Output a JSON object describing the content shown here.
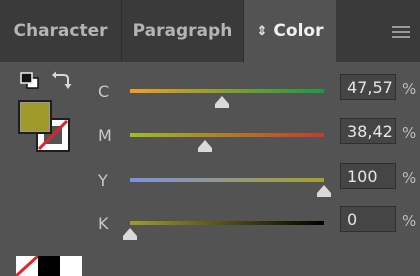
{
  "tabs": [
    {
      "label": "Character"
    },
    {
      "label": "Paragraph"
    },
    {
      "label": "Color"
    }
  ],
  "icons": {
    "tab_arrows": "⇕",
    "panel_menu": "menu-icon",
    "default_colors": "default-fill-stroke-icon",
    "swap": "swap-fill-stroke-icon"
  },
  "fill_color": "#9f9a2a",
  "sliders": [
    {
      "channel": "C",
      "value": "47,57",
      "unit": "%",
      "fraction": 0.4757,
      "gradient": [
        "#f0a020",
        "#1a9a45"
      ]
    },
    {
      "channel": "M",
      "value": "38,42",
      "unit": "%",
      "fraction": 0.3842,
      "gradient": [
        "#9abf22",
        "#c63a2b"
      ]
    },
    {
      "channel": "Y",
      "value": "100",
      "unit": "%",
      "fraction": 1.0,
      "gradient": [
        "#7f8fe0",
        "#a6a12a"
      ]
    },
    {
      "channel": "K",
      "value": "0",
      "unit": "%",
      "fraction": 0.0,
      "gradient": [
        "#a09c2a",
        "#000000"
      ]
    }
  ],
  "bottom_swatches": [
    "none",
    "#000000",
    "#ffffff"
  ]
}
